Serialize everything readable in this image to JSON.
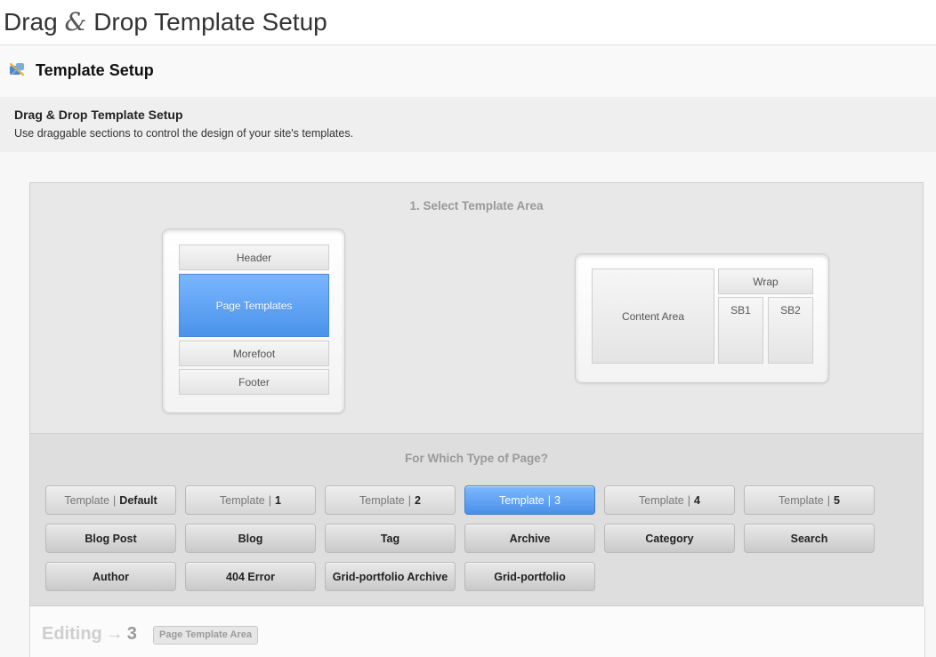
{
  "page": {
    "title_part1": "Drag",
    "title_amp": "&",
    "title_part2": "Drop Template Setup"
  },
  "panel": {
    "icon": "puzzle-tools-icon",
    "title": "Template Setup"
  },
  "intro": {
    "heading": "Drag & Drop Template Setup",
    "description": "Use draggable sections to control the design of your site's templates."
  },
  "select_area": {
    "title": "1. Select Template Area",
    "left_frame": {
      "header": "Header",
      "page_templates": "Page Templates",
      "morefoot": "Morefoot",
      "footer": "Footer"
    },
    "right_frame": {
      "content_area": "Content Area",
      "wrap": "Wrap",
      "sb1": "SB1",
      "sb2": "SB2"
    }
  },
  "page_type": {
    "title": "For Which Type of Page?",
    "template_prefix": "Template",
    "separator": "|",
    "templates": [
      "Default",
      "1",
      "2",
      "3",
      "4",
      "5"
    ],
    "selected_template": "3",
    "types_row2": [
      "Blog Post",
      "Blog",
      "Tag",
      "Archive",
      "Category",
      "Search"
    ],
    "types_row3": [
      "Author",
      "404 Error",
      "Grid-portfolio Archive",
      "Grid-portfolio"
    ]
  },
  "editing": {
    "label": "Editing",
    "arrow": "→",
    "number": "3",
    "badge": "Page Template Area"
  },
  "colors": {
    "accent_blue": "#5a9ff0",
    "panel_bg": "#e8e8e8"
  }
}
